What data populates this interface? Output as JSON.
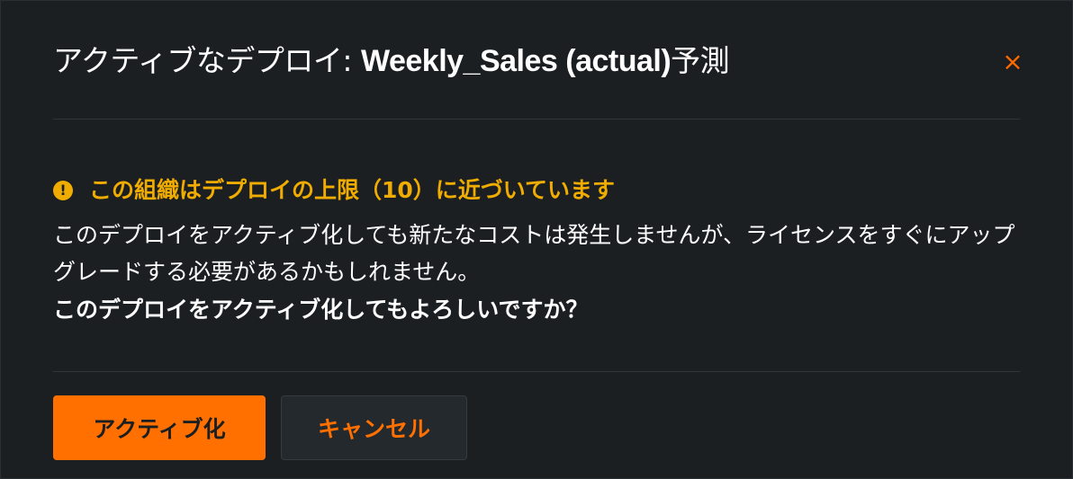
{
  "dialog": {
    "title_prefix": "アクティブなデプロイ: ",
    "title_name": "Weekly_Sales (actual)",
    "title_suffix": "予測",
    "close_label": "×"
  },
  "warning": {
    "icon": "!",
    "icon_name": "warning-icon",
    "text": "この組織はデプロイの上限（10）に近づいています",
    "color": "#f0ac00"
  },
  "message": {
    "body": "このデプロイをアクティブ化しても新たなコストは発生しませんが、ライセンスをすぐにアップグレードする必要があるかもしれません。",
    "confirm": "このデプロイをアクティブ化してもよろしいですか？"
  },
  "buttons": {
    "activate_label": "アクティブ化",
    "cancel_label": "キャンセル",
    "accent_color": "#ff7000"
  }
}
